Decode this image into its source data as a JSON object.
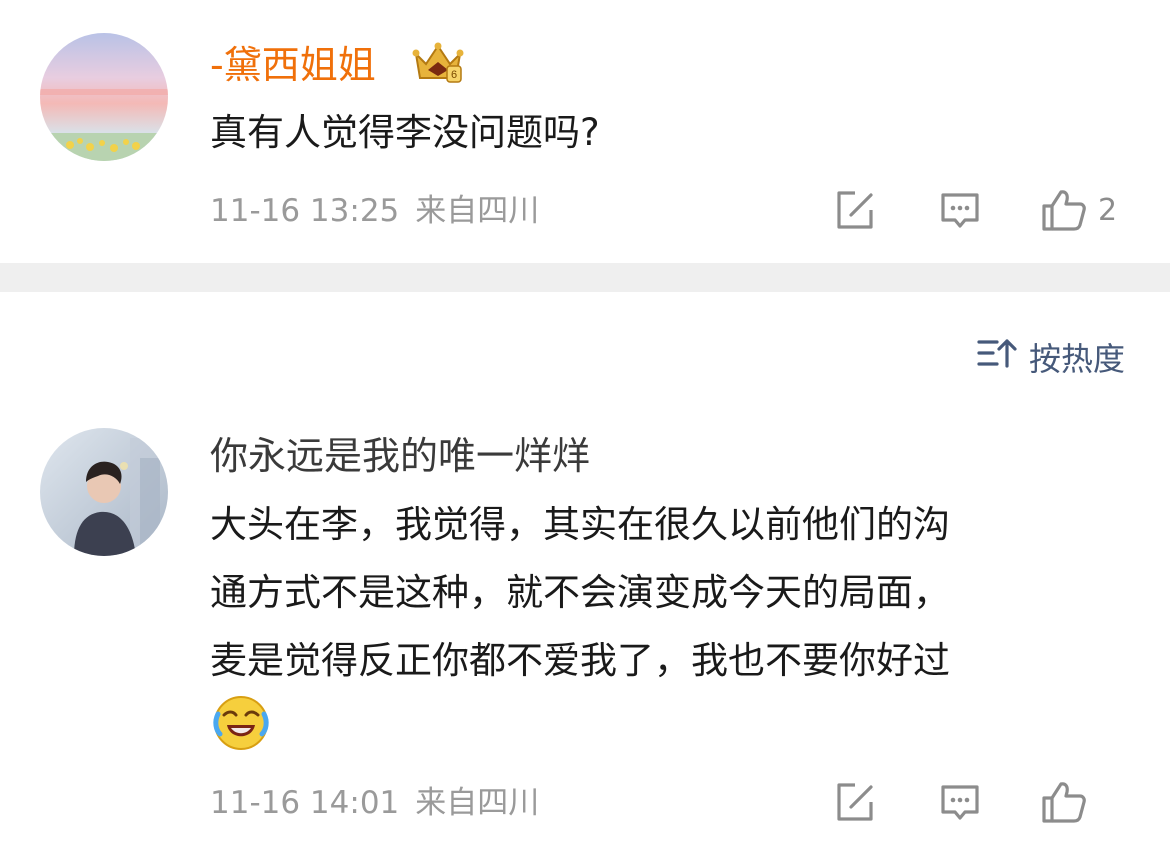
{
  "comment1": {
    "username": "-黛西姐姐",
    "text": "真有人觉得李没问题吗?",
    "time": "11-16 13:25",
    "location": "来自四川",
    "like_count": "2",
    "badge_icon": "crown-badge-icon",
    "colors": {
      "username": "#f0700a"
    }
  },
  "sort": {
    "label": "按热度",
    "icon": "sort-icon"
  },
  "comment2": {
    "username": "你永远是我的唯一烊烊",
    "lines": [
      "大头在李，我觉得，其实在很久以前他们的沟",
      "通方式不是这种，就不会演变成今天的局面，",
      "麦是觉得反正你都不爱我了，我也不要你好过"
    ],
    "emoji": "laughing-crying-emoji",
    "time": "11-16 14:01",
    "location": "来自四川",
    "colors": {
      "username": "#3a3a3a"
    }
  }
}
